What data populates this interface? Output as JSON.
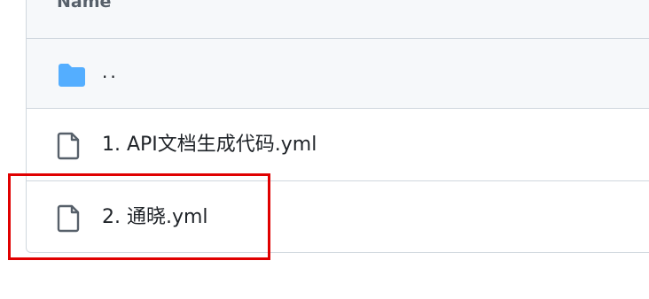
{
  "table": {
    "header": {
      "name_label": "Name"
    },
    "parent_row": {
      "label": "..",
      "icon": "folder-icon"
    },
    "files": [
      {
        "label": "1. API文档生成代码.yml",
        "icon": "file-icon"
      },
      {
        "label": "2. 通晓.yml",
        "icon": "file-icon"
      }
    ]
  },
  "colors": {
    "folder": "#54aeff",
    "file_icon": "#57606a",
    "border": "#d0d7de",
    "header_bg": "#f6f8fa",
    "highlight": "#e00000"
  }
}
